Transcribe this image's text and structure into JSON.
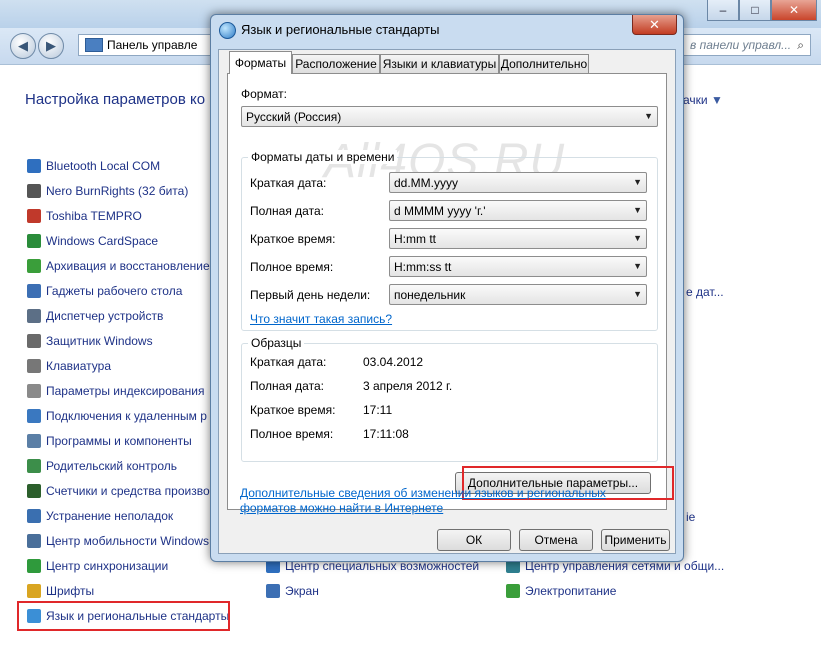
{
  "control_panel": {
    "address": "Панель управле",
    "search_placeholder": "в панели управл...",
    "heading": "Настройка параметров ко",
    "view_link": "ачки",
    "items_left": [
      {
        "label": "Bluetooth Local COM",
        "color": "#2f6fbf"
      },
      {
        "label": "Nero BurnRights (32 бита)",
        "color": "#555555"
      },
      {
        "label": "Toshiba TEMPRO",
        "color": "#c0392b"
      },
      {
        "label": "Windows CardSpace",
        "color": "#2a8c3a"
      },
      {
        "label": "Архивация и восстановление",
        "color": "#3a9e3a"
      },
      {
        "label": "Гаджеты рабочего стола",
        "color": "#3c6fb4"
      },
      {
        "label": "Диспетчер устройств",
        "color": "#5c6f86"
      },
      {
        "label": "Защитник Windows",
        "color": "#6a6a6a"
      },
      {
        "label": "Клавиатура",
        "color": "#777777"
      },
      {
        "label": "Параметры индексирования",
        "color": "#8a8a8a"
      },
      {
        "label": "Подключения к удаленным р",
        "color": "#3a78c0"
      },
      {
        "label": "Программы и компоненты",
        "color": "#5b7fa6"
      },
      {
        "label": "Родительский контроль",
        "color": "#3c8e4a"
      },
      {
        "label": "Счетчики и средства произво",
        "color": "#2c5f2c"
      },
      {
        "label": "Устранение неполадок",
        "color": "#3a6fb0"
      },
      {
        "label": "Центр мобильности Windows",
        "color": "#4a6f9a"
      },
      {
        "label": "Центр синхронизации",
        "color": "#2f9a3c"
      },
      {
        "label": "Шрифты",
        "color": "#d9a521"
      },
      {
        "label": "Язык и региональные стандарты",
        "color": "#3b8fd6"
      }
    ],
    "items_bottom": [
      {
        "label": "Центр специальных возможностей",
        "color": "#2f6fbf"
      },
      {
        "label": "Экран",
        "color": "#3c6fb4"
      },
      {
        "label": "Центр управления сетями и общи...",
        "color": "#2f7f8f"
      },
      {
        "label": "Электропитание",
        "color": "#3a9e3a"
      }
    ],
    "right_fragments": [
      "е дат...",
      "ie"
    ]
  },
  "dialog": {
    "title": "Язык и региональные стандарты",
    "close_glyph": "✕",
    "tabs": [
      "Форматы",
      "Расположение",
      "Языки и клавиатуры",
      "Дополнительно"
    ],
    "format_label": "Формат:",
    "format_value": "Русский (Россия)",
    "datetime_group_title": "Форматы даты и времени",
    "datetime_rows": [
      {
        "label": "Краткая дата:",
        "value": "dd.MM.yyyy"
      },
      {
        "label": "Полная дата:",
        "value": "d MMMM yyyy 'г.'"
      },
      {
        "label": "Краткое время:",
        "value": "H:mm tt"
      },
      {
        "label": "Полное время:",
        "value": "H:mm:ss tt"
      },
      {
        "label": "Первый день недели:",
        "value": "понедельник"
      }
    ],
    "what_means_link": "Что значит такая запись?",
    "samples_group_title": "Образцы",
    "samples": [
      {
        "label": "Краткая дата:",
        "value": "03.04.2012"
      },
      {
        "label": "Полная дата:",
        "value": "3 апреля 2012 г."
      },
      {
        "label": "Краткое время:",
        "value": "17:11"
      },
      {
        "label": "Полное время:",
        "value": "17:11:08"
      }
    ],
    "advanced_button": "Дополнительные параметры...",
    "info_link_line1": "Дополнительные сведения об изменении языков и региональных",
    "info_link_line2": "форматов можно найти в Интернете",
    "ok_button": "ОК",
    "cancel_button": "Отмена",
    "apply_button": "Применить"
  },
  "watermark": "All4OS.RU",
  "colors": {
    "highlight": "#e0282a",
    "link": "#0066cc",
    "cp_link": "#1e3287"
  }
}
